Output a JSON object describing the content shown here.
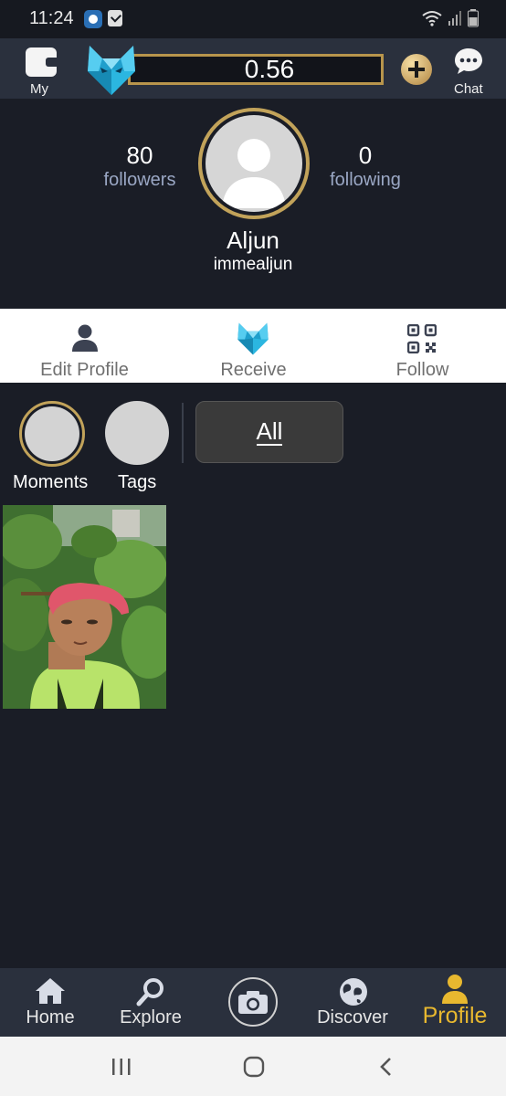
{
  "status_bar": {
    "time": "11:24"
  },
  "header": {
    "wallet_label": "My",
    "balance": "0.56",
    "chat_label": "Chat",
    "accent_gold": "#b8954c",
    "logo_color": "#2bb6e0"
  },
  "profile": {
    "followers_count": "80",
    "followers_label": "followers",
    "following_count": "0",
    "following_label": "following",
    "display_name": "Aljun",
    "username": "immealjun"
  },
  "actions": [
    {
      "label": "Edit Profile",
      "icon": "person-icon"
    },
    {
      "label": "Receive",
      "icon": "fox-logo-icon"
    },
    {
      "label": "Follow",
      "icon": "qr-code-icon"
    }
  ],
  "highlights": [
    {
      "label": "Moments"
    },
    {
      "label": "Tags"
    }
  ],
  "filter": {
    "selected": "All"
  },
  "posts": [
    {
      "type": "photo",
      "icon": "selfie-photo"
    }
  ],
  "bottom_nav": [
    {
      "label": "Home",
      "icon": "home-icon"
    },
    {
      "label": "Explore",
      "icon": "search-icon"
    },
    {
      "label": "",
      "icon": "camera-icon"
    },
    {
      "label": "Discover",
      "icon": "globe-icon"
    },
    {
      "label": "Profile",
      "icon": "person-icon",
      "active": true,
      "color": "#e8b82f"
    }
  ]
}
